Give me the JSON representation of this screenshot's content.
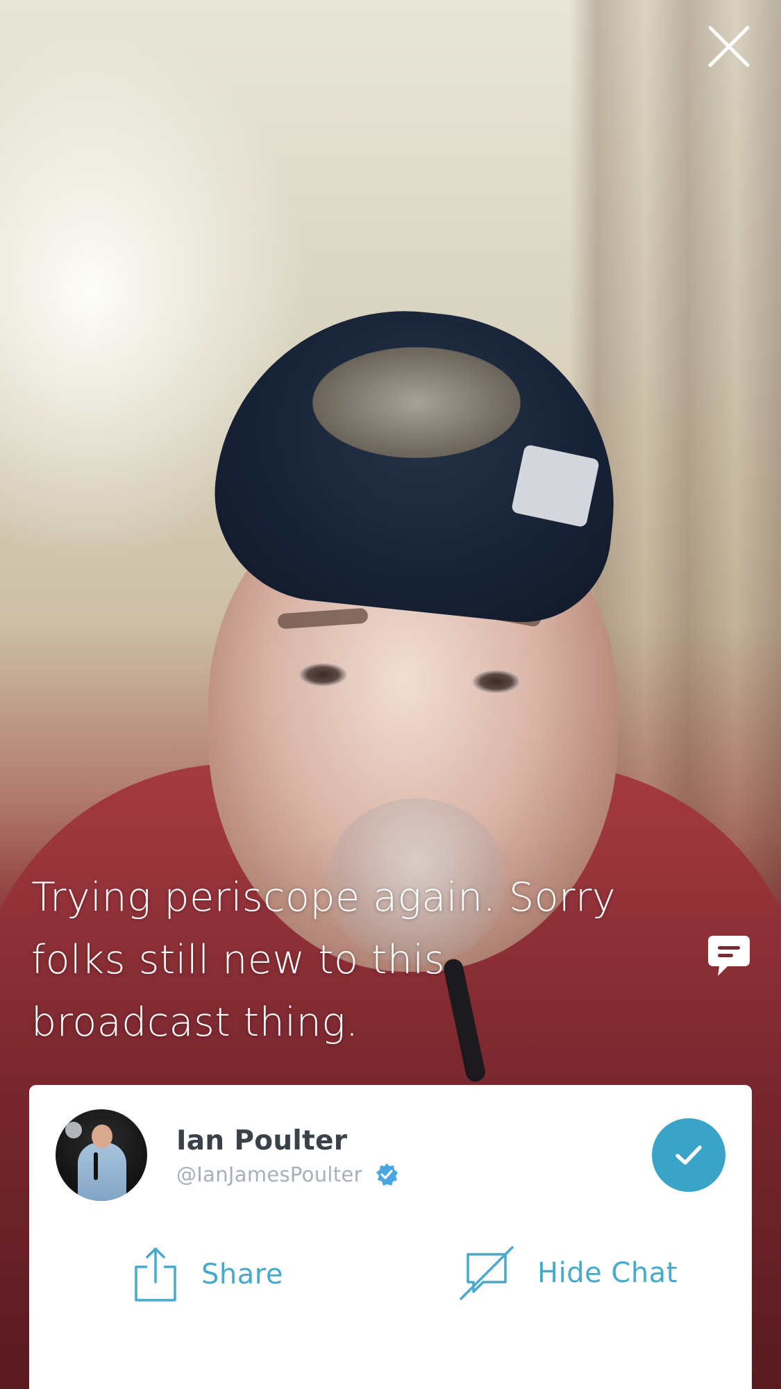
{
  "broadcast": {
    "caption": "Trying periscope again. Sorry folks still new to this broadcast thing."
  },
  "controls": {
    "close_icon": "close-icon",
    "chat_icon": "chat-bubble-icon"
  },
  "profile": {
    "name": "Ian Poulter",
    "handle": "@IanJamesPoulter",
    "verified": true,
    "following": true
  },
  "actions": {
    "share_label": "Share",
    "hide_chat_label": "Hide Chat"
  },
  "colors": {
    "accent": "#3aa4c8",
    "action_text": "#47a9cc",
    "name_text": "#3b4149",
    "handle_text": "#a7b0b8"
  }
}
